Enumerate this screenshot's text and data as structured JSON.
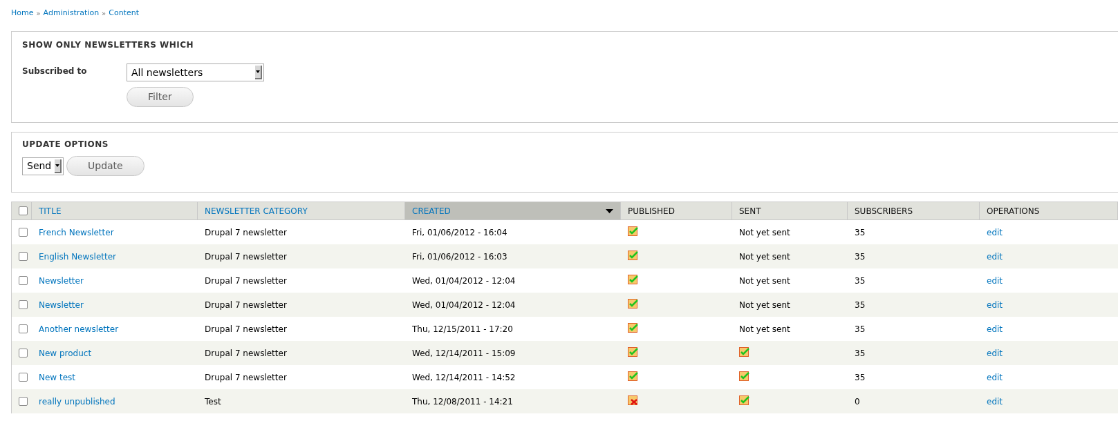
{
  "breadcrumb": [
    "Home",
    "Administration",
    "Content"
  ],
  "breadcrumb_separator": "»",
  "filter": {
    "title": "SHOW ONLY NEWSLETTERS WHICH",
    "label": "Subscribed to",
    "select_value": "All newsletters",
    "button": "Filter"
  },
  "update": {
    "title": "UPDATE OPTIONS",
    "select_value": "Send",
    "button": "Update"
  },
  "table": {
    "select_all_checked": false,
    "columns": [
      {
        "label": "TITLE",
        "sortable": true,
        "selected": false
      },
      {
        "label": "NEWSLETTER CATEGORY",
        "sortable": true,
        "selected": false
      },
      {
        "label": "CREATED",
        "sortable": true,
        "selected": true
      },
      {
        "label": "PUBLISHED",
        "sortable": false,
        "selected": false
      },
      {
        "label": "SENT",
        "sortable": false,
        "selected": false
      },
      {
        "label": "SUBSCRIBERS",
        "sortable": false,
        "selected": false
      },
      {
        "label": "OPERATIONS",
        "sortable": false,
        "selected": false
      }
    ],
    "rows": [
      {
        "checked": false,
        "title": "French Newsletter",
        "category": "Drupal 7 newsletter",
        "created": "Fri, 01/06/2012 - 16:04",
        "published": true,
        "sent": {
          "kind": "text",
          "text": "Not yet sent"
        },
        "subscribers": "35",
        "operation": "edit"
      },
      {
        "checked": false,
        "title": "English Newsletter",
        "category": "Drupal 7 newsletter",
        "created": "Fri, 01/06/2012 - 16:03",
        "published": true,
        "sent": {
          "kind": "text",
          "text": "Not yet sent"
        },
        "subscribers": "35",
        "operation": "edit"
      },
      {
        "checked": false,
        "title": "Newsletter",
        "category": "Drupal 7 newsletter",
        "created": "Wed, 01/04/2012 - 12:04",
        "published": true,
        "sent": {
          "kind": "text",
          "text": "Not yet sent"
        },
        "subscribers": "35",
        "operation": "edit"
      },
      {
        "checked": false,
        "title": "Newsletter",
        "category": "Drupal 7 newsletter",
        "created": "Wed, 01/04/2012 - 12:04",
        "published": true,
        "sent": {
          "kind": "text",
          "text": "Not yet sent"
        },
        "subscribers": "35",
        "operation": "edit"
      },
      {
        "checked": false,
        "title": "Another newsletter",
        "category": "Drupal 7 newsletter",
        "created": "Thu, 12/15/2011 - 17:20",
        "published": true,
        "sent": {
          "kind": "text",
          "text": "Not yet sent"
        },
        "subscribers": "35",
        "operation": "edit"
      },
      {
        "checked": false,
        "title": "New product",
        "category": "Drupal 7 newsletter",
        "created": "Wed, 12/14/2011 - 15:09",
        "published": true,
        "sent": {
          "kind": "icon",
          "done": true
        },
        "subscribers": "35",
        "operation": "edit"
      },
      {
        "checked": false,
        "title": "New test",
        "category": "Drupal 7 newsletter",
        "created": "Wed, 12/14/2011 - 14:52",
        "published": true,
        "sent": {
          "kind": "icon",
          "done": true
        },
        "subscribers": "35",
        "operation": "edit"
      },
      {
        "checked": false,
        "title": "really unpublished",
        "category": "Test",
        "created": "Thu, 12/08/2011 - 14:21",
        "published": false,
        "sent": {
          "kind": "icon",
          "done": true
        },
        "subscribers": "0",
        "operation": "edit"
      }
    ]
  }
}
